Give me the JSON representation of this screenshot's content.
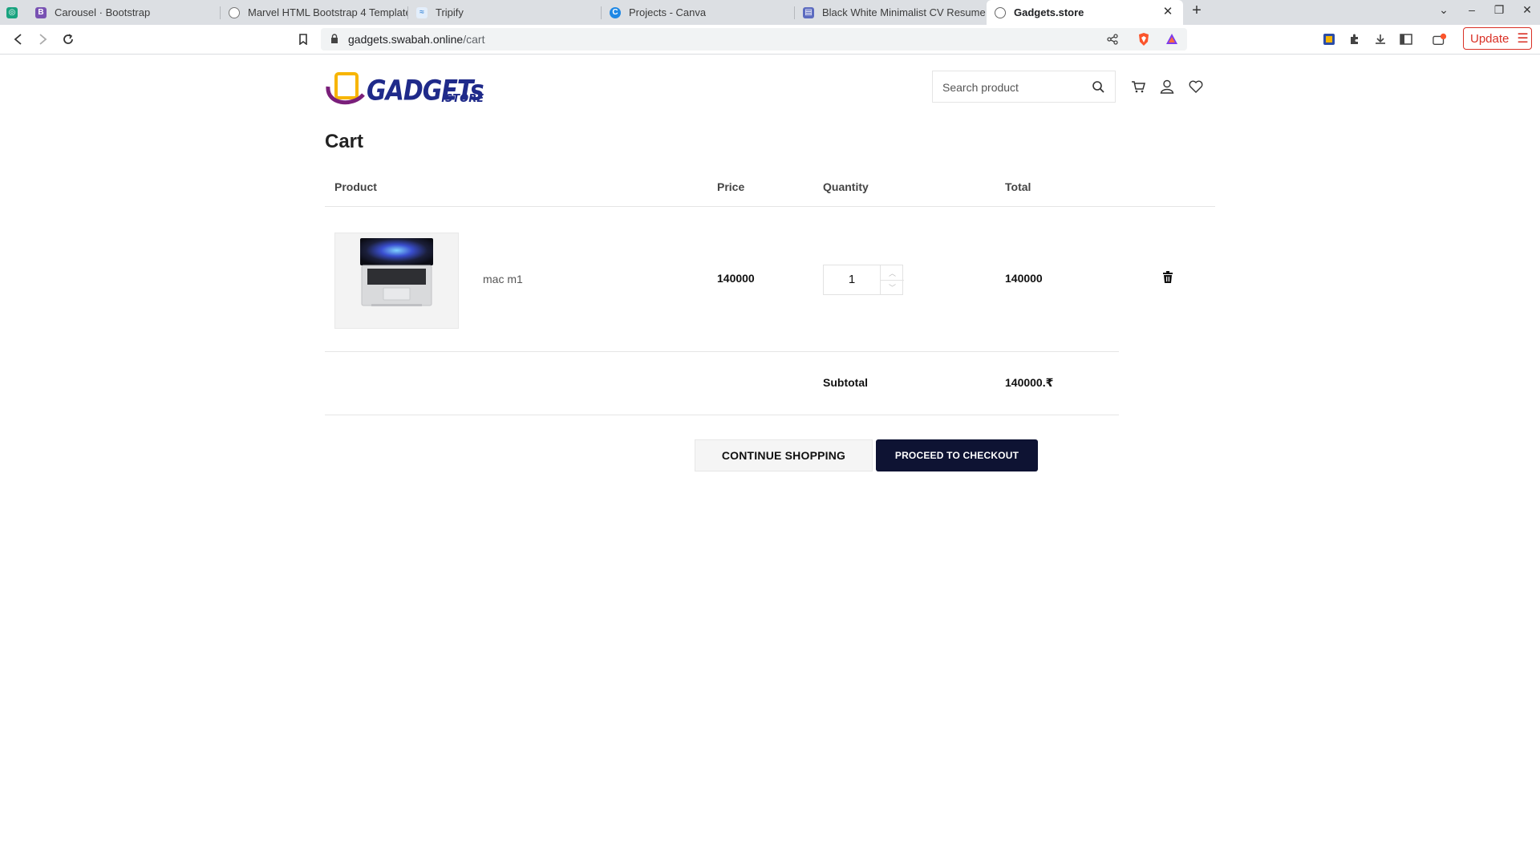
{
  "browser": {
    "tabs": [
      {
        "title": "Carousel · Bootstrap",
        "favicon": "bootstrap-icon",
        "favicon_color": "#7952b3"
      },
      {
        "title": "Marvel HTML Bootstrap 4 Template",
        "favicon": "globe-icon",
        "favicon_color": "#555555"
      },
      {
        "title": "Tripify",
        "favicon": "tripify-icon",
        "favicon_color": "#4a90d9"
      },
      {
        "title": "Projects - Canva",
        "favicon": "canva-icon",
        "favicon_color": "#1e88e5"
      },
      {
        "title": "Black White Minimalist CV Resume",
        "favicon": "canva-doc-icon",
        "favicon_color": "#5c6bc0"
      },
      {
        "title": "Gadgets.store",
        "favicon": "globe-icon",
        "favicon_color": "#555555"
      }
    ],
    "active_tab_index": 5,
    "url_host": "gadgets.swabah.online",
    "url_path": "/cart",
    "update_label": "Update"
  },
  "header": {
    "logo_text": "GADGETs",
    "logo_suffix": ".STORE",
    "search_placeholder": "Search product"
  },
  "cart": {
    "title": "Cart",
    "columns": {
      "product": "Product",
      "price": "Price",
      "quantity": "Quantity",
      "total": "Total"
    },
    "items": [
      {
        "name": "mac m1",
        "price": "140000",
        "quantity": "1",
        "total": "140000"
      }
    ],
    "subtotal_label": "Subtotal",
    "subtotal_value": "140000.₹",
    "continue_label": "CONTINUE SHOPPING",
    "checkout_label": "PROCEED TO CHECKOUT"
  },
  "colors": {
    "checkout_bg": "#0e1333",
    "brand": "#1f2a8a",
    "update": "#d93025"
  }
}
